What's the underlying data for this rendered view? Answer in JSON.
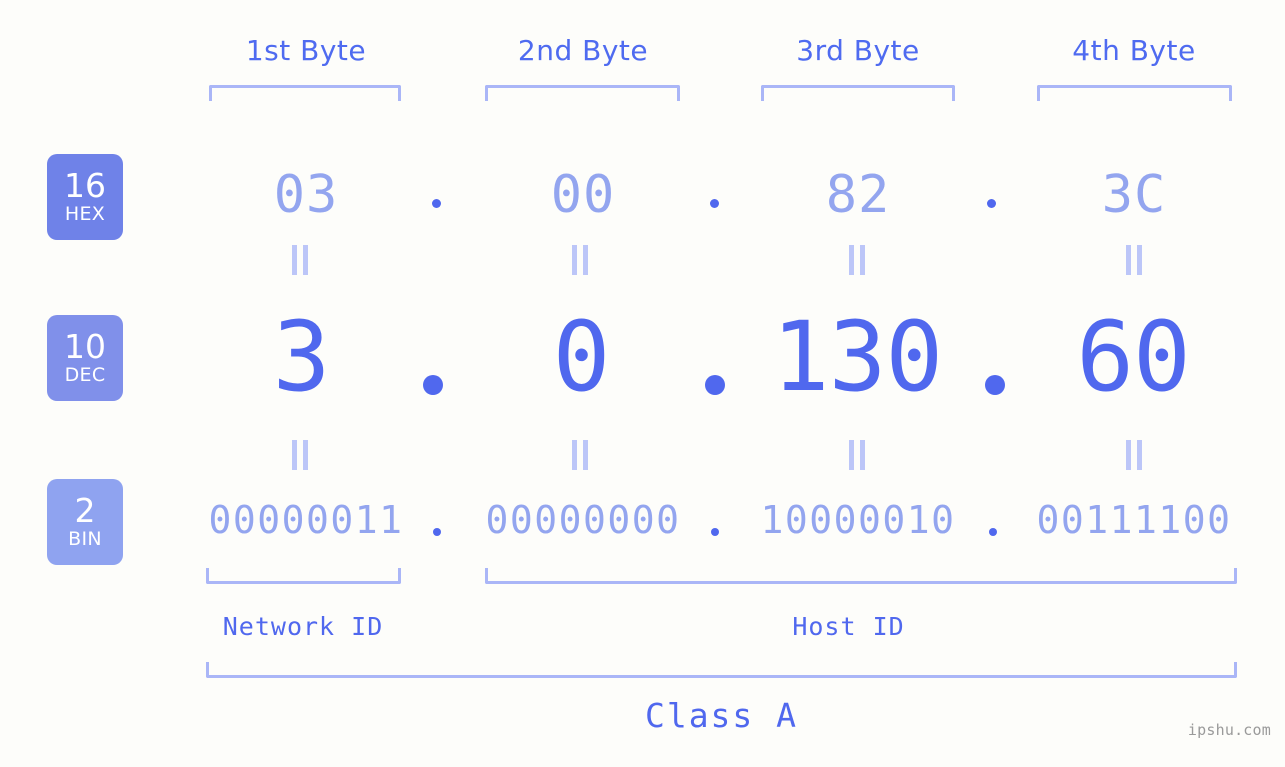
{
  "background_color": "#fdfdfa",
  "accent_color": "#5068ee",
  "muted_accent_color": "#93a5ef",
  "bracket_color": "#aab6f7",
  "header": {
    "bytes": [
      {
        "label": "1st Byte"
      },
      {
        "label": "2nd Byte"
      },
      {
        "label": "3rd Byte"
      },
      {
        "label": "4th Byte"
      }
    ]
  },
  "rows": [
    {
      "badge_number": "16",
      "badge_base": "HEX",
      "badge_color": "#6f82e8",
      "octets": [
        "03",
        "00",
        "82",
        "3C"
      ],
      "separator": "."
    },
    {
      "badge_number": "10",
      "badge_base": "DEC",
      "badge_color": "#8090ea",
      "octets": [
        "3",
        "0",
        "130",
        "60"
      ],
      "separator": "."
    },
    {
      "badge_number": "2",
      "badge_base": "BIN",
      "badge_color": "#8fa3f0",
      "octets": [
        "00000011",
        "00000000",
        "10000010",
        "00111100"
      ],
      "separator": "."
    }
  ],
  "equality_marks": {
    "symbol": "=",
    "count_per_gap": 4,
    "gaps": 2
  },
  "groups": [
    {
      "label": "Network ID"
    },
    {
      "label": "Host ID"
    }
  ],
  "class": {
    "label": "Class A"
  },
  "watermark": {
    "text": "ipshu.com"
  }
}
